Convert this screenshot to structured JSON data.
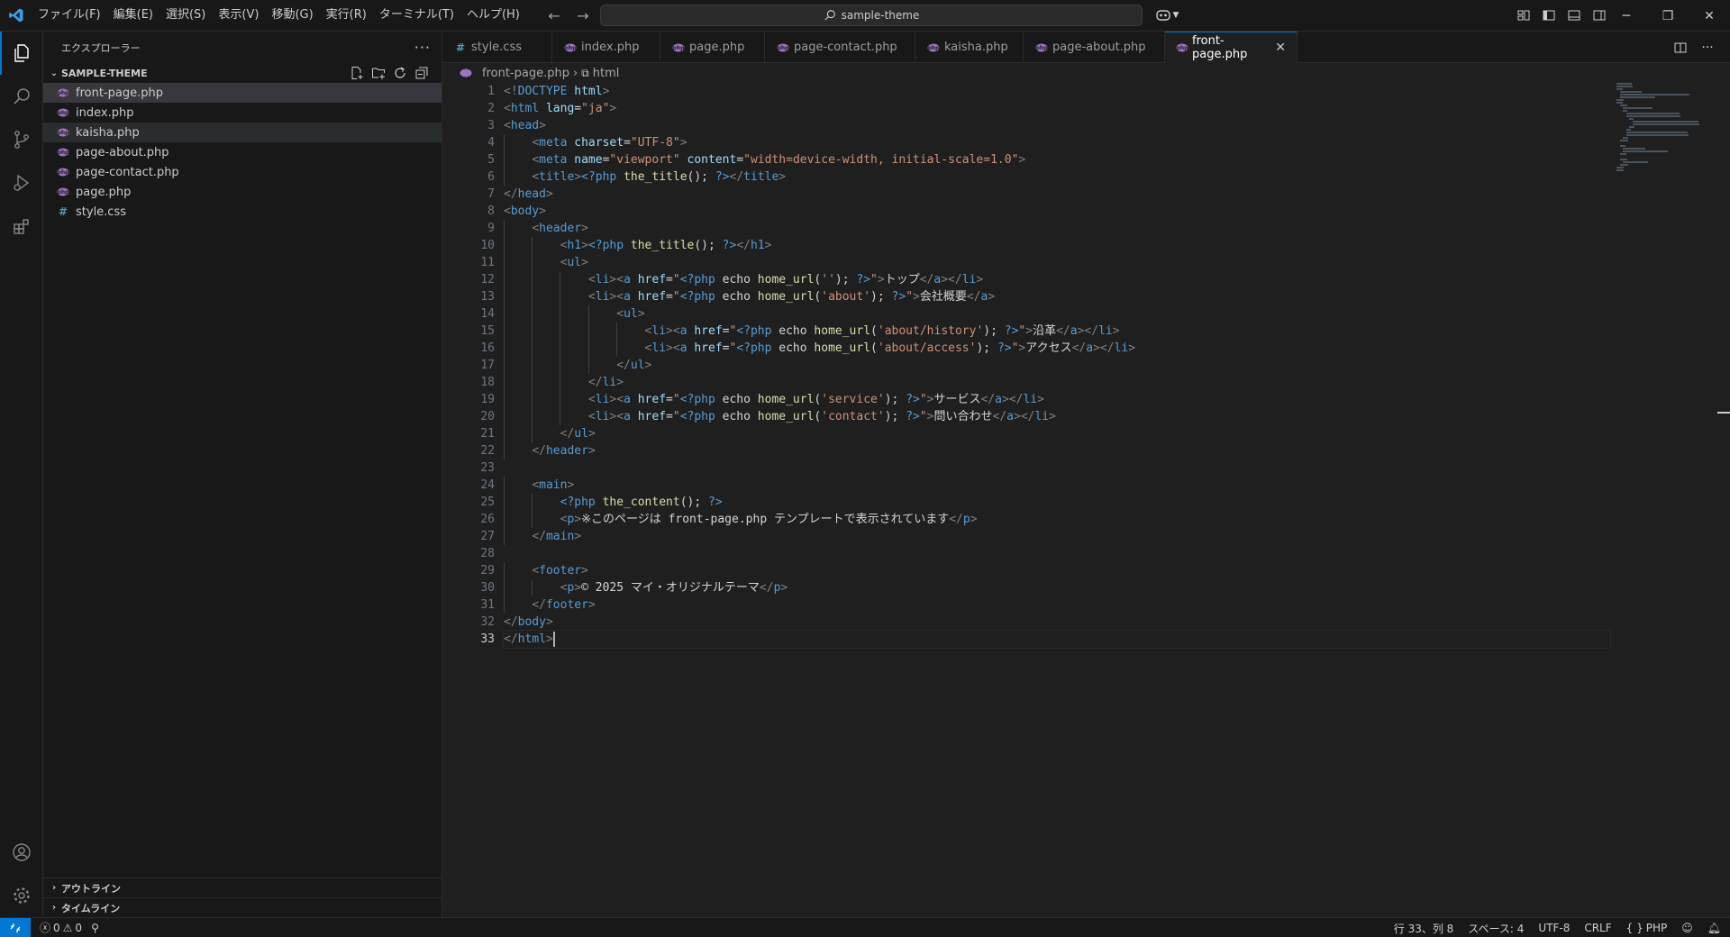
{
  "titlebar": {
    "menus": [
      "ファイル(F)",
      "編集(E)",
      "選択(S)",
      "表示(V)",
      "移動(G)",
      "実行(R)",
      "ターミナル(T)",
      "ヘルプ(H)"
    ],
    "command_center": "sample-theme"
  },
  "sidebar": {
    "title": "エクスプローラー",
    "folder": "SAMPLE-THEME",
    "files": [
      {
        "name": "front-page.php",
        "type": "php"
      },
      {
        "name": "index.php",
        "type": "php"
      },
      {
        "name": "kaisha.php",
        "type": "php"
      },
      {
        "name": "page-about.php",
        "type": "php"
      },
      {
        "name": "page-contact.php",
        "type": "php"
      },
      {
        "name": "page.php",
        "type": "php"
      },
      {
        "name": "style.css",
        "type": "css"
      }
    ],
    "outline_label": "アウトライン",
    "timeline_label": "タイムライン"
  },
  "tabs": [
    {
      "name": "style.css",
      "type": "css"
    },
    {
      "name": "index.php",
      "type": "php"
    },
    {
      "name": "page.php",
      "type": "php"
    },
    {
      "name": "page-contact.php",
      "type": "php"
    },
    {
      "name": "kaisha.php",
      "type": "php"
    },
    {
      "name": "page-about.php",
      "type": "php"
    },
    {
      "name": "front-page.php",
      "type": "php",
      "active": true
    }
  ],
  "breadcrumbs": {
    "file": "front-page.php",
    "symbol": "html"
  },
  "editor": {
    "lines": [
      "<!DOCTYPE html>",
      "<html lang=\"ja\">",
      "<head>",
      "    <meta charset=\"UTF-8\">",
      "    <meta name=\"viewport\" content=\"width=device-width, initial-scale=1.0\">",
      "    <title><?php the_title(); ?></title>",
      "</head>",
      "<body>",
      "    <header>",
      "        <h1><?php the_title(); ?></h1>",
      "        <ul>",
      "            <li><a href=\"<?php echo home_url(''); ?>\">トップ</a></li>",
      "            <li><a href=\"<?php echo home_url('about'); ?>\">会社概要</a>",
      "                <ul>",
      "                    <li><a href=\"<?php echo home_url('about/history'); ?>\">沿革</a></li>",
      "                    <li><a href=\"<?php echo home_url('about/access'); ?>\">アクセス</a></li>",
      "                </ul>",
      "            </li>",
      "            <li><a href=\"<?php echo home_url('service'); ?>\">サービス</a></li>",
      "            <li><a href=\"<?php echo home_url('contact'); ?>\">問い合わせ</a></li>",
      "        </ul>",
      "    </header>",
      "",
      "    <main>",
      "        <?php the_content(); ?>",
      "        <p>※このページは front-page.php テンプレートで表示されています</p>",
      "    </main>",
      "",
      "    <footer>",
      "        <p>© 2025 マイ・オリジナルテーマ</p>",
      "    </footer>",
      "</body>",
      "</html>"
    ],
    "current_line": 33
  },
  "statusbar": {
    "errors": "0",
    "warnings": "0",
    "position": "行 33、列 8",
    "spaces": "スペース: 4",
    "encoding": "UTF-8",
    "eol": "CRLF",
    "language": "PHP"
  },
  "colors": {
    "accent": "#0078d4",
    "php_icon": "#a074c4"
  }
}
